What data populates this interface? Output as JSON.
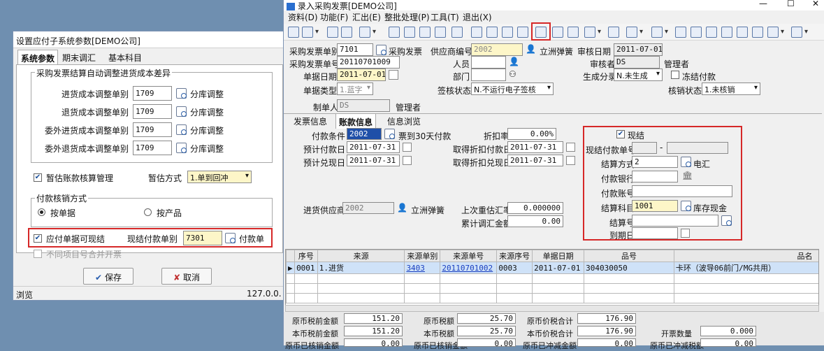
{
  "dialog": {
    "title": "设置应付子系统参数[DEMO公司]",
    "tabs": [
      "系统参数",
      "期末调汇",
      "基本科目"
    ],
    "group1": "采购发票结算自动调整进货成本差异",
    "rows": [
      {
        "label": "进货成本调整单别",
        "value": "1709",
        "link": "分库调整"
      },
      {
        "label": "退货成本调整单别",
        "value": "1709",
        "link": "分库调整"
      },
      {
        "label": "委外进货成本调整单别",
        "value": "1709",
        "link": "分库调整"
      },
      {
        "label": "委外退货成本调整单别",
        "value": "1709",
        "link": "分库调整"
      }
    ],
    "estimate_label": "暂估账款核算管理",
    "estimate_mode_label": "暂估方式",
    "estimate_mode_value": "1.单到回冲",
    "group2": "付款核销方式",
    "radio1": "按单据",
    "radio2": "按产品",
    "payable_cash": "应付单据可现结",
    "cash_doc_label": "现结付款单别",
    "cash_doc_value": "7301",
    "cash_doc_link": "付款单",
    "merge_label": "不同项目号合并开票",
    "save": "保存",
    "cancel": "取消",
    "status_left": "浏览",
    "status_right": "127.0.0."
  },
  "win": {
    "title": "录入采购发票[DEMO公司]",
    "menu": [
      "资料(D)",
      "功能(F)",
      "汇出(E)",
      "整批处理(P)",
      "工具(T)",
      "退出(X)"
    ],
    "header": {
      "inv_type_label": "采购发票单别",
      "inv_type": "7101",
      "inv_type_name": "采购发票",
      "inv_no_label": "采购发票单号",
      "inv_no": "20110701009",
      "date_label": "单据日期",
      "date": "2011-07-01",
      "kind_label": "单据类型",
      "kind": "1.蓝字",
      "maker_label": "制单人",
      "maker": "DS",
      "maker_name": "管理者",
      "supplier_label": "供应商编号",
      "supplier": "2002",
      "supplier_name": "立洲弹簧",
      "person_label": "人员",
      "dept_label": "部门",
      "sign_label": "签核状态",
      "sign": "N.不运行电子签核",
      "audit_date_label": "审核日期",
      "audit_date": "2011-07-01",
      "auditor_label": "审核者",
      "auditor": "DS",
      "auditor_name": "管理者",
      "gen_label": "生成分录",
      "gen": "N.未生成",
      "freeze_label": "冻结付款",
      "verify_label": "核销状态",
      "verify": "1.未核销"
    },
    "tabs": [
      "发票信息",
      "账款信息",
      "信息浏览"
    ],
    "acct": {
      "terms_label": "付款条件",
      "terms": "2002",
      "terms_name": "票到30天付款",
      "pre_pay_label": "预计付款日",
      "pre_pay": "2011-07-31",
      "pre_cash_label": "预计兑现日",
      "pre_cash": "2011-07-31",
      "discount_label": "折扣率",
      "discount": "0.00%",
      "disc_pay_label": "取得折扣付款日",
      "disc_pay": "2011-07-31",
      "disc_cash_label": "取得折扣兑现日",
      "disc_cash": "2011-07-31",
      "in_supplier_label": "进货供应商",
      "in_supplier": "2002",
      "in_supplier_name": "立洲弹簧",
      "reval_label": "上次重估汇率",
      "reval": "0.000000",
      "adj_label": "累计调汇金额",
      "adj": "0.00"
    },
    "cash": {
      "cash_label": "现结",
      "no_label": "现结付款单号",
      "method_label": "结算方式",
      "method": "2",
      "method_name": "电汇",
      "bank_label": "付款银行",
      "account_label": "付款账号",
      "subject_label": "结算科目",
      "subject": "1001",
      "subject_name": "库存现金",
      "settle_no_label": "结算号",
      "due_label": "到期日"
    },
    "grid": {
      "headers": [
        "序号",
        "来源",
        "来源单别",
        "来源单号",
        "来源序号",
        "单据日期",
        "品号",
        "品名"
      ],
      "row": [
        "0001",
        "1.进货",
        "3403",
        "20110701002",
        "0003",
        "2011-07-01",
        "304030050",
        "卡环（波导06前门/MG共用）"
      ]
    },
    "totals": {
      "r1": [
        {
          "label": "原币税前金额",
          "value": "151.20"
        },
        {
          "label": "原币税额",
          "value": "25.70"
        },
        {
          "label": "原币价税合计",
          "value": "176.90"
        }
      ],
      "r2": [
        {
          "label": "本币税前金额",
          "value": "151.20"
        },
        {
          "label": "本币税额",
          "value": "25.70"
        },
        {
          "label": "本币价税合计",
          "value": "176.90"
        },
        {
          "label": "开票数量",
          "value": "0.000"
        }
      ],
      "r3": [
        {
          "label": "原币已核销金额",
          "value": "0.00"
        },
        {
          "label": "原币已核销金额",
          "value": "0.00"
        },
        {
          "label": "原币已冲减金额",
          "value": "0.00"
        },
        {
          "label": "原币已冲减税额",
          "value": "0.00"
        }
      ]
    }
  }
}
